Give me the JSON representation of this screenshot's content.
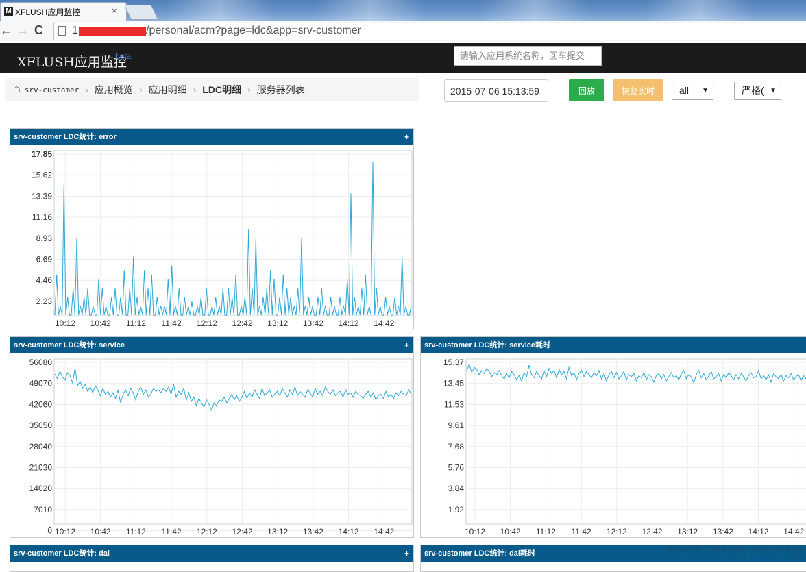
{
  "browser": {
    "tab_title": "XFLUSH应用监控",
    "tab_favicon": "M",
    "tab_close": "×",
    "url_prefix": "1",
    "url_text": "/personal/acm?page=ldc&app=srv-customer"
  },
  "app": {
    "brand": "XFLUSH应用监控",
    "beta": "beta",
    "search_placeholder": "请输入应用系统名称，回车提交"
  },
  "breadcrumb": {
    "items": [
      "srv-customer",
      "应用概览",
      "应用明细",
      "LDC明细",
      "服务器列表"
    ],
    "separator": "›"
  },
  "toolbar": {
    "time_value": "2015-07-06 15:13:59",
    "replay_label": "回放",
    "realtime_label": "恢复实时",
    "scope_select": "all",
    "mode_select": "严格("
  },
  "colors": {
    "header": "#075a8a",
    "line": "#2ba8d8",
    "replay": "#2aac4b",
    "realtime": "#f4c06f"
  },
  "chart_data": [
    {
      "type": "line",
      "title": "srv-customer LDC统计: error",
      "x": [
        "10:12",
        "10:42",
        "11:12",
        "11:42",
        "12:12",
        "12:42",
        "13:12",
        "13:42",
        "14:12",
        "14:42"
      ],
      "y_ticks": [
        "17.85",
        "15.62",
        "13.39",
        "11.16",
        "8.93",
        "6.69",
        "4.46",
        "2.23"
      ],
      "ylim": [
        0,
        17.85
      ],
      "series": [
        {
          "values": [
            0,
            4.5,
            0,
            1,
            0,
            14.5,
            0,
            2,
            0,
            0,
            3,
            0,
            8.5,
            0,
            1,
            0,
            2,
            0,
            3,
            0,
            0,
            1,
            0,
            0,
            4,
            0,
            3,
            0,
            1,
            0,
            0,
            2,
            0,
            3,
            0,
            0,
            2,
            0,
            5,
            0,
            0,
            3,
            0,
            6.5,
            0,
            2,
            0,
            1,
            0,
            5,
            0,
            3,
            0,
            4.5,
            0,
            0,
            2,
            0,
            1,
            0,
            1,
            0,
            4,
            0,
            5.5,
            0,
            1,
            0,
            3,
            0,
            0,
            2,
            0,
            1,
            0,
            1.5,
            0,
            0,
            1,
            0,
            2,
            0,
            0,
            3,
            0,
            0,
            1,
            0,
            2,
            0,
            1,
            0,
            3,
            0,
            0,
            3,
            0,
            2,
            0,
            4.5,
            0,
            0,
            1,
            0,
            2,
            0,
            9.5,
            0,
            3,
            0,
            8.5,
            0,
            1,
            0,
            2,
            0,
            3,
            0,
            5,
            0,
            4,
            0,
            0,
            2,
            0,
            4.5,
            0,
            3,
            0,
            2,
            0,
            1,
            0,
            3,
            0,
            8.5,
            0,
            1,
            0,
            2,
            0,
            1,
            0,
            0,
            2,
            0,
            3,
            0,
            1,
            0,
            0,
            2,
            0,
            1,
            0,
            0,
            2,
            0,
            1,
            0,
            4,
            0,
            13.5,
            0,
            2,
            0,
            1,
            0,
            3,
            0,
            4.5,
            0,
            1,
            0,
            17,
            0,
            3,
            0,
            1,
            0,
            0,
            2,
            0,
            1,
            0,
            0,
            2,
            0,
            1,
            0,
            6.5,
            0,
            1,
            0,
            0,
            1
          ]
        }
      ]
    },
    {
      "type": "line",
      "title": "srv-customer LDC统计: service",
      "x": [
        "10:12",
        "10:42",
        "11:12",
        "11:42",
        "12:12",
        "12:42",
        "13:12",
        "13:42",
        "14:12",
        "14:42"
      ],
      "y_ticks": [
        "56080",
        "49070",
        "42060",
        "35050",
        "28040",
        "21030",
        "14020",
        "7010",
        "0"
      ],
      "ylim": [
        0,
        56080
      ],
      "series": [
        {
          "values": [
            52000,
            50500,
            53000,
            51000,
            50000,
            52500,
            51500,
            49000,
            54000,
            48000,
            49500,
            47000,
            48500,
            46000,
            47500,
            45500,
            48000,
            46500,
            44500,
            47000,
            45000,
            46000,
            44000,
            45500,
            43500,
            46500,
            42000,
            45000,
            46500,
            44500,
            47000,
            45500,
            43000,
            46000,
            47500,
            45000,
            46500,
            44000,
            45000,
            47000,
            46000,
            46500,
            45500,
            47000,
            46000,
            47500,
            45000,
            48500,
            44000,
            46000,
            45000,
            47000,
            43000,
            45500,
            42500,
            44000,
            41000,
            43500,
            42000,
            40500,
            43000,
            41500,
            39500,
            42000,
            41000,
            43000,
            42500,
            44000,
            42000,
            43500,
            45000,
            43000,
            44500,
            42500,
            44000,
            46000,
            43500,
            45500,
            44000,
            46500,
            45000,
            43500,
            47000,
            44500,
            45500,
            46500,
            44000,
            45000,
            46000,
            44500,
            47000,
            45500,
            44000,
            46500,
            45000,
            47500,
            44500,
            46000,
            45000,
            44000,
            46500,
            45500,
            44000,
            47000,
            45000,
            46000,
            44500,
            47500,
            46000,
            45000,
            46500,
            44500,
            45500,
            46000,
            44000,
            46500,
            45000,
            45500,
            44000,
            46000,
            45000,
            44500,
            43500,
            45000,
            46000,
            44000,
            45500,
            43000,
            44500,
            45000,
            43500,
            46000,
            44000,
            45000,
            43500,
            45500,
            44500,
            46000,
            45000,
            44500,
            46500,
            45000
          ]
        }
      ]
    },
    {
      "type": "line",
      "title": "srv-customer LDC统计: service耗时",
      "x": [
        "10:12",
        "10:42",
        "11:12",
        "11:42",
        "12:12",
        "12:42",
        "13:12",
        "13:42",
        "14:12",
        "14:42"
      ],
      "y_ticks": [
        "15.37",
        "13.45",
        "11.53",
        "9.61",
        "7.68",
        "5.76",
        "3.84",
        "1.92"
      ],
      "ylim": [
        0,
        15.37
      ],
      "series": [
        {
          "values": [
            14.6,
            15.2,
            14.4,
            14.9,
            14.7,
            14.2,
            14.6,
            14.3,
            14.8,
            14.5,
            14.0,
            14.4,
            14.2,
            14.6,
            14.1,
            13.8,
            14.3,
            13.9,
            14.5,
            14.2,
            13.7,
            14.1,
            13.6,
            14.4,
            14.0,
            15.1,
            14.2,
            13.9,
            14.5,
            14.1,
            13.8,
            14.6,
            14.0,
            14.8,
            14.3,
            14.6,
            13.9,
            14.7,
            14.2,
            14.5,
            13.8,
            14.9,
            14.1,
            14.4,
            13.7,
            14.3,
            14.6,
            14.0,
            14.5,
            14.2,
            13.9,
            14.4,
            14.1,
            14.6,
            13.8,
            14.3,
            13.6,
            14.2,
            14.5,
            13.9,
            14.4,
            13.8,
            14.1,
            14.5,
            13.7,
            14.2,
            14.0,
            14.3,
            13.6,
            14.1,
            13.9,
            14.4,
            13.7,
            14.2,
            14.0,
            13.5,
            14.1,
            14.3,
            13.8,
            14.2,
            13.6,
            14.0,
            14.4,
            13.9,
            14.1,
            13.7,
            14.3,
            14.6,
            13.8,
            14.2,
            14.0,
            13.4,
            14.2,
            14.6,
            13.9,
            14.3,
            13.7,
            14.1,
            14.5,
            13.8,
            14.0,
            14.3,
            13.6,
            14.2,
            13.9,
            14.4,
            14.1,
            13.7,
            14.2,
            13.8,
            14.3,
            14.0,
            13.6,
            14.1,
            14.4,
            13.9,
            14.0,
            14.6,
            13.8,
            14.1,
            13.7,
            14.2,
            13.5,
            14.3,
            14.0,
            13.8,
            14.2,
            13.6,
            14.1,
            13.9,
            14.3,
            13.7,
            14.0,
            14.2,
            13.6,
            14.1,
            13.8
          ]
        }
      ]
    }
  ],
  "panels_lower": {
    "dal_title": "srv-customer LDC统计: dal",
    "dal_cost_title": "srv-customer LDC统计: dal耗时",
    "plus": "+"
  }
}
